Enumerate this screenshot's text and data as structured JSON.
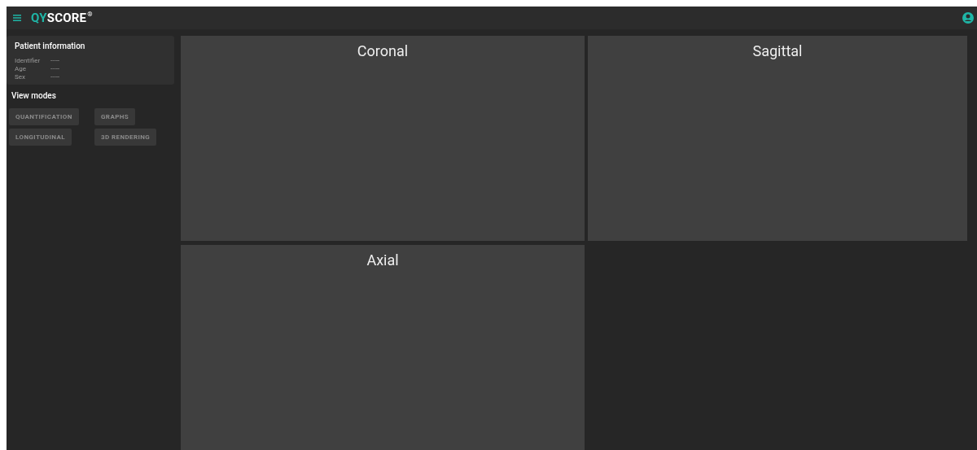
{
  "header": {
    "logo_prefix": "QY",
    "logo_name": "SCORE",
    "logo_mark": "®"
  },
  "patient_information": {
    "title": "Patient information",
    "fields": [
      {
        "label": "Identifier",
        "value": "-----"
      },
      {
        "label": "Age",
        "value": "-----"
      },
      {
        "label": "Sex",
        "value": "-----"
      }
    ]
  },
  "view_modes": {
    "title": "View modes",
    "buttons": [
      {
        "label": "QUANTIFICATION",
        "disabled": true
      },
      {
        "label": "GRAPHS",
        "disabled": true
      },
      {
        "label": "LONGITUDINAL",
        "disabled": true
      },
      {
        "label": "3D RENDERING",
        "disabled": true
      }
    ]
  },
  "views": [
    {
      "title": "Coronal"
    },
    {
      "title": "Sagittal"
    },
    {
      "title": "Axial"
    }
  ]
}
